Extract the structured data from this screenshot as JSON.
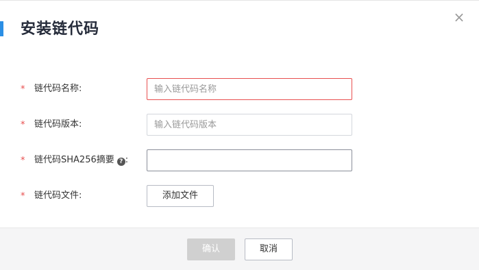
{
  "dialog": {
    "title": "安装链代码",
    "close_label": "×"
  },
  "form": {
    "required_mark": "*",
    "fields": [
      {
        "label": "链代码名称:",
        "value": "",
        "placeholder": "输入链代码名称",
        "state": "error"
      },
      {
        "label": "链代码版本:",
        "value": "",
        "placeholder": "输入链代码版本",
        "state": "normal"
      },
      {
        "label": "链代码SHA256摘要",
        "label_suffix": ":",
        "help_icon": "question-circle-icon",
        "help_glyph": "?",
        "value": "",
        "placeholder": "",
        "state": "focused"
      },
      {
        "label": "链代码文件:",
        "button_label": "添加文件"
      }
    ]
  },
  "footer": {
    "confirm_label": "确认",
    "confirm_disabled": true,
    "cancel_label": "取消"
  },
  "colors": {
    "accent": "#2b8fe5",
    "required": "#e84e4e",
    "error_border": "#e84e4e",
    "disabled_button": "#d0d0d0"
  }
}
